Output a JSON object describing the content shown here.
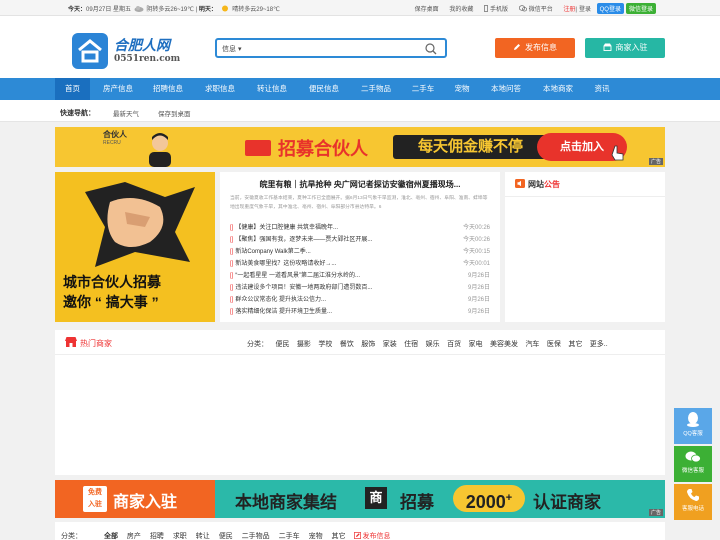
{
  "topbar": {
    "today_label": "今天：",
    "today_date": "09月27日 星期五",
    "today_weather": "阴转多云26~19℃",
    "tomorrow_label": "明天：",
    "tomorrow_weather": "晴转多云29~18℃",
    "links": [
      "保存桌面",
      "我的收藏",
      "手机版",
      "微信平台"
    ],
    "register": "注册",
    "login": "登录",
    "qq_login": "QQ登录",
    "wx_login": "微信登录"
  },
  "header": {
    "logo_text": "合肥人网",
    "logo_domain": "0551ren.com",
    "search_category": "信息",
    "publish_btn": "发布信息",
    "shop_btn": "商家入驻"
  },
  "nav": [
    "首页",
    "房产信息",
    "招聘信息",
    "求职信息",
    "转让信息",
    "便民信息",
    "二手物品",
    "二手车",
    "宠物",
    "本地问答",
    "本地商家",
    "资讯"
  ],
  "quick": {
    "label": "快速导航：",
    "links": [
      "最新天气",
      "保存到桌面"
    ]
  },
  "banner1": {
    "badge": "合伙人",
    "badge_en": "RECRU",
    "title": "招募合伙人",
    "slogan": "每天佣金赚不停",
    "button": "点击加入",
    "ad": "广告"
  },
  "left_promo": {
    "line1": "城市合伙人招募",
    "line2": "邀你 “ 搞大事 ”"
  },
  "news": {
    "headline": "皖里有粮｜抗旱抢种 央广网记者探访安徽宿州夏播现场...",
    "summary": "当前，安徽夏收工作基本结束，夏种工作已全面展开。据6月13日气象干旱监测，淮北、亳州、宿州、阜阳、淮南、蚌埠等地出现重度气象干旱，其中淮北、亳州、宿州、阜阳部分市县达特旱。6",
    "items": [
      {
        "tag": "[]",
        "text": "【健康】关注口腔健康 共筑幸福晚年...",
        "date": "今天00:26"
      },
      {
        "tag": "[]",
        "text": "【聚焦】强国有我，逐梦未来——贾大郢社区开展...",
        "date": "今天00:26"
      },
      {
        "tag": "[]",
        "text": "新站Company Walk第二季...",
        "date": "今天00:15"
      },
      {
        "tag": "[]",
        "text": "新站美食哪里找？这份攻略请收好→...",
        "date": "今天00:01"
      },
      {
        "tag": "[]",
        "text": "“一起看星星 一道看风景”第二届江淮分水岭的...",
        "date": "9月26日"
      },
      {
        "tag": "[]",
        "text": "违法建设多个项目！安徽一地两政府部门遭罚数百...",
        "date": "9月26日"
      },
      {
        "tag": "[]",
        "text": "群众公议常态化 提升执法公信力...",
        "date": "9月26日"
      },
      {
        "tag": "[]",
        "text": "落实精细化保洁 提升环境卫生质量...",
        "date": "9月26日"
      }
    ]
  },
  "notice": {
    "title_a": "网站",
    "title_b": "公告"
  },
  "hot": {
    "title": "热门商家",
    "cat_label": "分类：",
    "cats": [
      "便民",
      "摄影",
      "学校",
      "餐饮",
      "服饰",
      "家装",
      "住宿",
      "娱乐",
      "百货",
      "家电",
      "美容美发",
      "汽车",
      "医保",
      "其它",
      "更多.."
    ]
  },
  "banner2": {
    "tag1": "免费",
    "tag2": "入驻",
    "title": "商家入驻",
    "slogan": "本地商家集结",
    "shang": "商",
    "recruit": "招募",
    "num": "2000",
    "sup": "+",
    "cert": "认证商家",
    "ad": "广告"
  },
  "bottom": {
    "cat_label": "分类：",
    "cats": [
      "全部",
      "房产",
      "招聘",
      "求职",
      "转让",
      "便民",
      "二手物品",
      "二手车",
      "宠物",
      "其它"
    ],
    "publish": "发布信息"
  },
  "side": [
    {
      "label": "QQ客服",
      "color": "#5aa7e8"
    },
    {
      "label": "微信客服",
      "color": "#3cb035"
    },
    {
      "label": "客服电话",
      "color": "#f0a020"
    }
  ],
  "colors": {
    "brand": "#2d8ad6",
    "orange": "#f26522",
    "teal": "#26b7a4",
    "red": "#e33333",
    "yellow": "#f7c631"
  }
}
